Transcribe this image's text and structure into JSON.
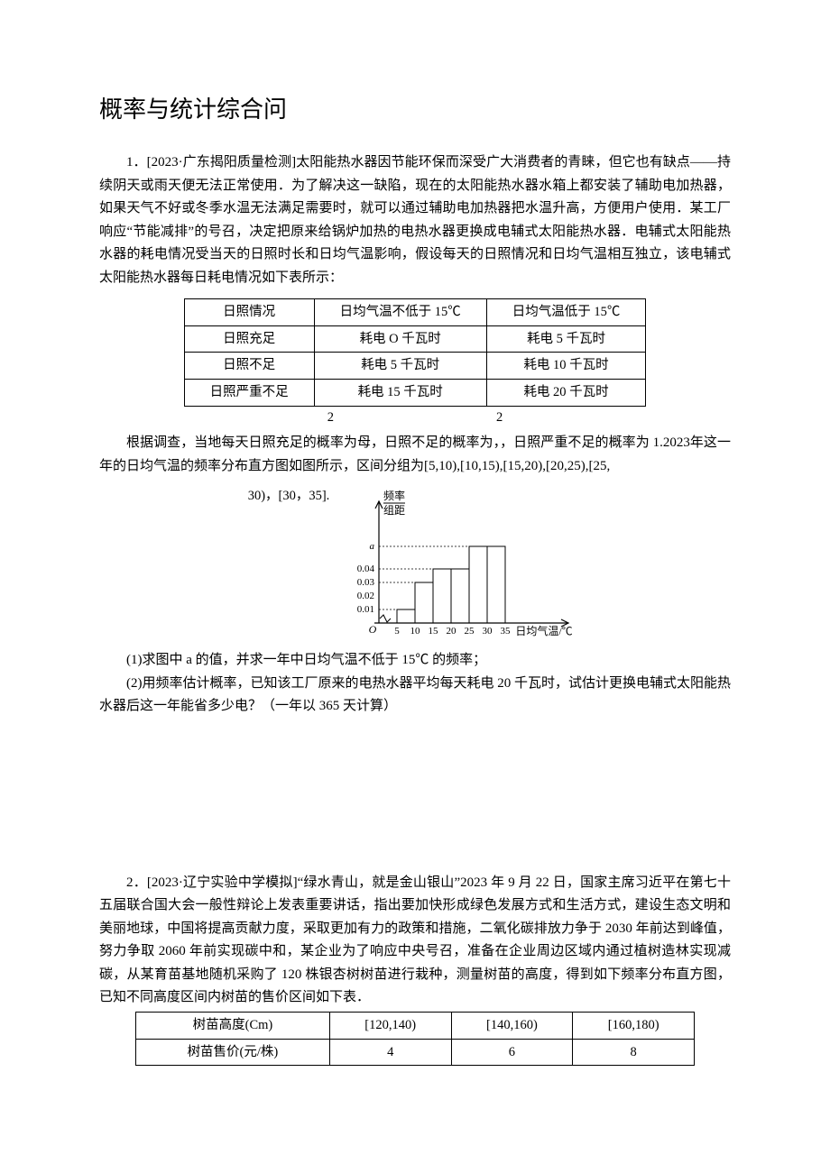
{
  "title": "概率与统计综合问",
  "q1": {
    "lead": "1．[2023·广东揭阳质量检测]太阳能热水器因节能环保而深受广大消费者的青睐，但它也有缺点——持续阴天或雨天便无法正常使用．为了解决这一缺陷，现在的太阳能热水器水箱上都安装了辅助电加热器，如果天气不好或冬季水温无法满足需要时，就可以通过辅助电加热器把水温升高，方便用户使用．某工厂响应“节能减排”的号召，决定把原来给锅炉加热的电热水器更换成电辅式太阳能热水器．电辅式太阳能热水器的耗电情况受当天的日照时长和日均气温影响，假设每天的日照情况和日均气温相互独立，该电辅式太阳能热水器每日耗电情况如下表所示：",
    "t1": {
      "h": [
        "日照情况",
        "日均气温不低于 15℃",
        "日均气温低于 15℃"
      ],
      "r1": [
        "日照充足",
        "耗电 O 千瓦时",
        "耗电 5 千瓦时"
      ],
      "r2": [
        "日照不足",
        "耗电 5 千瓦时",
        "耗电 10 千瓦时"
      ],
      "r3": [
        "日照严重不足",
        "耗电 15 千瓦时",
        "耗电 20 千瓦时"
      ]
    },
    "two_a": "2",
    "two_b": "2",
    "para2": "根据调查，当地每天日照充足的概率为母，日照不足的概率为，，日照严重不足的概率为 1.2023年这一年的日均气温的频率分布直方图如图所示，区间分组为[5,10),[10,15),[15,20),[20,25),[25,",
    "chart_caption": "30)，[30，35].",
    "sub1": "(1)求图中 a 的值，并求一年中日均气温不低于 15℃ 的频率；",
    "sub2": "(2)用频率估计概率，已知该工厂原来的电热水器平均每天耗电 20 千瓦时，试估计更换电辅式太阳能热水器后这一年能省多少电？（一年以 365 天计算）"
  },
  "q2": {
    "lead": "2．[2023·辽宁实验中学模拟]“绿水青山，就是金山银山”2023 年 9 月 22 日，国家主席习近平在第七十五届联合国大会一般性辩论上发表重要讲话，指出要加快形成绿色发展方式和生活方式，建设生态文明和美丽地球，中国将提高贡献力度，采取更加有力的政策和措施，二氧化碳排放力争于 2030 年前达到峰值，努力争取 2060 年前实现碳中和，某企业为了响应中央号召，准备在企业周边区域内通过植树造林实现减碳，从某育苗基地随机采购了 120 株银杏树树苗进行栽种，测量树苗的高度，得到如下频率分布直方图，已知不同高度区间内树苗的售价区间如下表．",
    "t2": {
      "h": [
        "树苗高度(Cm)",
        "[120,140)",
        "[140,160)",
        "[160,180)"
      ],
      "r1": [
        "树苗售价(元/株)",
        "4",
        "6",
        "8"
      ]
    }
  },
  "chart_data": {
    "type": "bar",
    "title": "",
    "ylabel": "频率/组距",
    "xlabel": "日均气温/℃",
    "bin_width": 5,
    "categories": [
      "[5,10)",
      "[10,15)",
      "[15,20)",
      "[20,25)",
      "[25,30)",
      "[30,35)"
    ],
    "x_ticks": [
      5,
      10,
      15,
      20,
      25,
      30,
      35
    ],
    "y_ticks_numeric": [
      0.01,
      0.02,
      0.03,
      0.04
    ],
    "y_top_label": "a",
    "values": [
      0.01,
      0.03,
      0.04,
      0.04,
      "a",
      "a"
    ],
    "ylim": [
      0,
      0.06
    ],
    "note": "last two bars extend to the 'a' gridline above 0.04"
  },
  "chart_labels": {
    "ylabel_top": "频率",
    "ylabel_bot": "组距",
    "a": "a",
    "y1": "0.01",
    "y2": "0.02",
    "y3": "0.03",
    "y4": "0.04",
    "x5": "5",
    "x10": "10",
    "x15": "15",
    "x20": "20",
    "x25": "25",
    "x30": "30",
    "x35": "35",
    "xlabel": "日均气温/℃",
    "O": "O"
  }
}
